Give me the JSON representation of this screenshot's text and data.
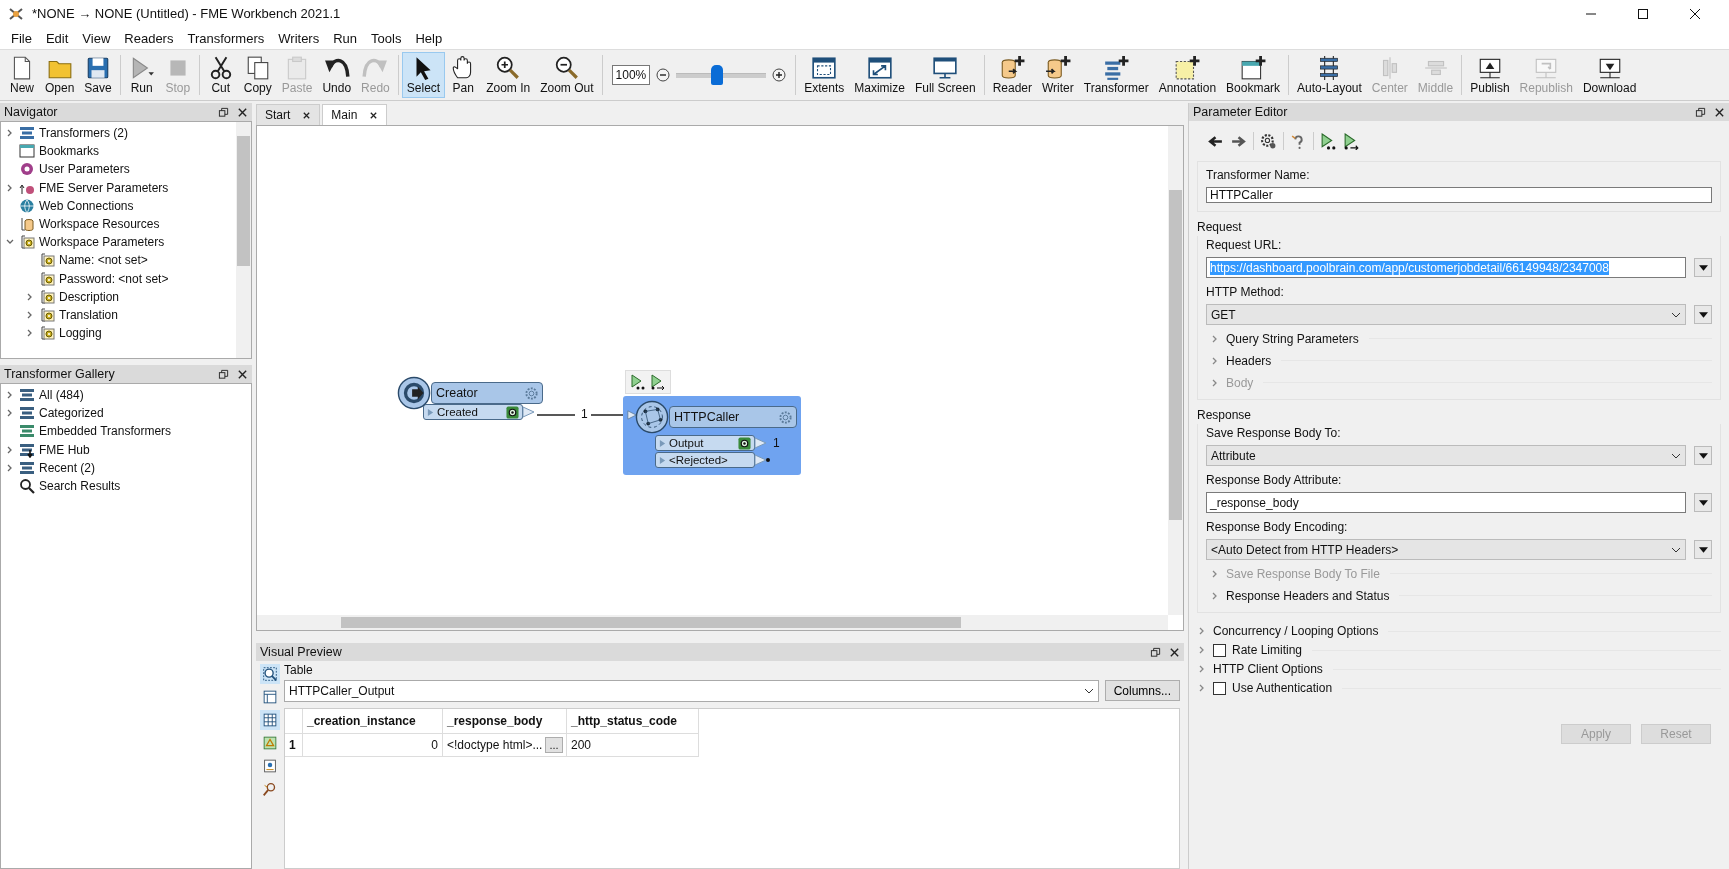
{
  "window": {
    "title": "*NONE → NONE (Untitled) - FME Workbench 2021.1"
  },
  "menu": [
    "File",
    "Edit",
    "View",
    "Readers",
    "Transformers",
    "Writers",
    "Run",
    "Tools",
    "Help"
  ],
  "toolbar": [
    {
      "kind": "buttons",
      "items": [
        {
          "label": "New",
          "disabled": false,
          "selected": false
        },
        {
          "label": "Open",
          "disabled": false,
          "selected": false
        },
        {
          "label": "Save",
          "disabled": false,
          "selected": false
        }
      ]
    },
    {
      "kind": "buttons",
      "items": [
        {
          "label": "Run",
          "disabled": false,
          "selected": false
        },
        {
          "label": "Stop",
          "disabled": true,
          "selected": false
        }
      ]
    },
    {
      "kind": "buttons",
      "items": [
        {
          "label": "Cut",
          "disabled": false,
          "selected": false
        },
        {
          "label": "Copy",
          "disabled": false,
          "selected": false
        },
        {
          "label": "Paste",
          "disabled": true,
          "selected": false
        },
        {
          "label": "Undo",
          "disabled": false,
          "selected": false
        },
        {
          "label": "Redo",
          "disabled": true,
          "selected": false
        }
      ]
    },
    {
      "kind": "buttons",
      "items": [
        {
          "label": "Select",
          "disabled": false,
          "selected": true
        },
        {
          "label": "Pan",
          "disabled": false,
          "selected": false
        },
        {
          "label": "Zoom In",
          "disabled": false,
          "selected": false
        },
        {
          "label": "Zoom Out",
          "disabled": false,
          "selected": false
        }
      ]
    },
    {
      "kind": "zoom",
      "value": "100%",
      "level": 0.45
    },
    {
      "kind": "buttons",
      "items": [
        {
          "label": "Extents",
          "disabled": false,
          "selected": false
        },
        {
          "label": "Maximize",
          "disabled": false,
          "selected": false
        },
        {
          "label": "Full Screen",
          "disabled": false,
          "selected": false
        }
      ]
    },
    {
      "kind": "buttons",
      "items": [
        {
          "label": "Reader",
          "disabled": false,
          "selected": false
        },
        {
          "label": "Writer",
          "disabled": false,
          "selected": false
        },
        {
          "label": "Transformer",
          "disabled": false,
          "selected": false
        },
        {
          "label": "Annotation",
          "disabled": false,
          "selected": false
        },
        {
          "label": "Bookmark",
          "disabled": false,
          "selected": false
        }
      ]
    },
    {
      "kind": "buttons",
      "items": [
        {
          "label": "Auto-Layout",
          "disabled": false,
          "selected": false
        },
        {
          "label": "Center",
          "disabled": true,
          "selected": false
        },
        {
          "label": "Middle",
          "disabled": true,
          "selected": false
        }
      ]
    },
    {
      "kind": "buttons",
      "items": [
        {
          "label": "Publish",
          "disabled": false,
          "selected": false
        },
        {
          "label": "Republish",
          "disabled": true,
          "selected": false
        },
        {
          "label": "Download",
          "disabled": false,
          "selected": false
        }
      ]
    }
  ],
  "navigator": {
    "title": "Navigator",
    "items": [
      {
        "label": "Transformers (2)",
        "expanded": false
      },
      {
        "label": "Bookmarks"
      },
      {
        "label": "User Parameters"
      },
      {
        "label": "FME Server Parameters",
        "expanded": false
      },
      {
        "label": "Web Connections"
      },
      {
        "label": "Workspace Resources"
      },
      {
        "label": "Workspace Parameters",
        "expanded": true,
        "children": [
          {
            "label": "Name: <not set>"
          },
          {
            "label": "Password: <not set>"
          },
          {
            "label": "Description",
            "expanded": false
          },
          {
            "label": "Translation",
            "expanded": false
          },
          {
            "label": "Logging",
            "expanded": false
          }
        ]
      }
    ]
  },
  "gallery": {
    "title": "Transformer Gallery",
    "items": [
      {
        "label": "All (484)",
        "expanded": false
      },
      {
        "label": "Categorized",
        "expanded": false
      },
      {
        "label": "Embedded Transformers"
      },
      {
        "label": "FME Hub",
        "expanded": false
      },
      {
        "label": "Recent (2)",
        "expanded": false
      },
      {
        "label": "Search Results"
      }
    ]
  },
  "tabs": [
    {
      "label": "Start",
      "selected": false
    },
    {
      "label": "Main",
      "selected": true
    }
  ],
  "canvas": {
    "nodes": [
      {
        "name": "Creator",
        "selected": false,
        "ports": [
          {
            "label": "Created",
            "inspect": true
          }
        ]
      },
      {
        "name": "HTTPCaller",
        "selected": true,
        "ports": [
          {
            "label": "Output",
            "inspect": true,
            "count": "1"
          },
          {
            "label": "<Rejected>",
            "inspect": false
          }
        ]
      }
    ],
    "connections": [
      {
        "label": "1"
      }
    ]
  },
  "visual_preview": {
    "title": "Visual Preview",
    "side_tools": [
      {
        "selected": true
      },
      {
        "selected": false
      },
      {
        "selected": true
      },
      {
        "selected": false
      },
      {
        "selected": false
      },
      {
        "selected": false
      }
    ],
    "view_label": "Table",
    "source": "HTTPCaller_Output",
    "columns_button": "Columns...",
    "table": {
      "columns": [
        "_creation_instance",
        "_response_body",
        "_http_status_code"
      ],
      "rows": [
        {
          "number": "1",
          "cells": [
            {
              "text": "0"
            },
            {
              "text": "<!doctype html>...",
              "button": "..."
            },
            {
              "text": "200"
            }
          ]
        }
      ]
    }
  },
  "parameter_editor": {
    "title": "Parameter Editor",
    "name_label": "Transformer Name:",
    "name_value": "HTTPCaller",
    "groups": [
      {
        "title": "Request",
        "fields": [
          {
            "label": "Request URL:",
            "kind": "text",
            "value": "https://dashboard.poolbrain.com/app/customerjobdetail/66149948/2347008",
            "highlighted": true
          },
          {
            "label": "HTTP Method:",
            "kind": "select",
            "value": "GET",
            "highlighted": false
          }
        ],
        "sections": [
          {
            "label": "Query String Parameters",
            "disabled": false
          },
          {
            "label": "Headers",
            "disabled": false
          },
          {
            "label": "Body",
            "disabled": true
          }
        ]
      },
      {
        "title": "Response",
        "fields": [
          {
            "label": "Save Response Body To:",
            "kind": "select",
            "value": "Attribute",
            "highlighted": false
          },
          {
            "label": "Response Body Attribute:",
            "kind": "text",
            "value": "_response_body",
            "highlighted": false
          },
          {
            "label": "Response Body Encoding:",
            "kind": "select",
            "value": "<Auto Detect from HTTP Headers>",
            "highlighted": false
          }
        ],
        "sections": [
          {
            "label": "Save Response Body To File",
            "disabled": true
          },
          {
            "label": "Response Headers and Status",
            "disabled": false
          }
        ]
      }
    ],
    "options": [
      {
        "label": "Concurrency / Looping Options",
        "kind": "section"
      },
      {
        "label": "Rate Limiting",
        "kind": "checkbox",
        "checked": false
      },
      {
        "label": "HTTP Client Options",
        "kind": "section"
      },
      {
        "label": "Use Authentication",
        "kind": "checkbox",
        "checked": false
      }
    ],
    "buttons": [
      {
        "label": "Apply",
        "disabled": true
      },
      {
        "label": "Reset",
        "disabled": true
      }
    ]
  }
}
